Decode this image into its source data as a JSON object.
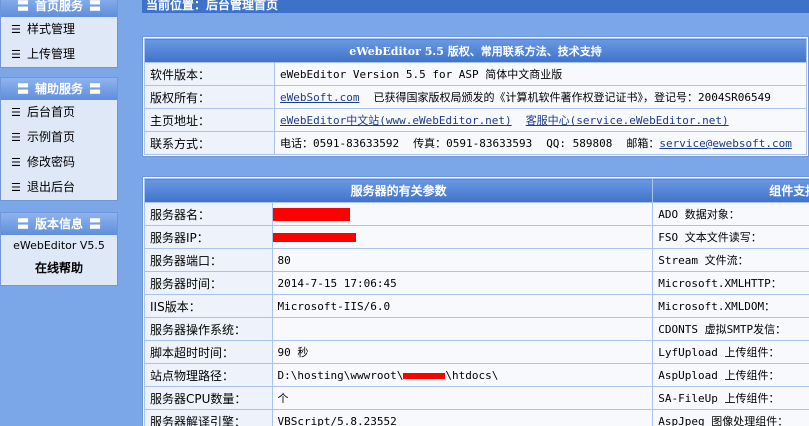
{
  "sidebar": {
    "panel1": {
      "title": "首页服务",
      "items": [
        {
          "label": "样式管理"
        },
        {
          "label": "上传管理"
        }
      ]
    },
    "panel2": {
      "title": "辅助服务",
      "items": [
        {
          "label": "后台首页"
        },
        {
          "label": "示例首页"
        },
        {
          "label": "修改密码"
        },
        {
          "label": "退出后台"
        }
      ]
    },
    "panel3": {
      "title": "版本信息",
      "version": "eWebEditor V5.5",
      "help": "在线帮助"
    },
    "eq": "〓"
  },
  "topbar": {
    "location": "当前位置：后台管理首页"
  },
  "version_table": {
    "title": "eWebEditor 5.5 版权、常用联系方法、技术支持",
    "rows": {
      "software_label": "软件版本：",
      "software_value": "eWebEditor Version 5.5 for ASP 简体中文商业版",
      "copyright_label": "版权所有：",
      "copyright_link": "eWebSoft.com",
      "copyright_text": "已获得国家版权局颁发的《计算机软件著作权登记证书》，登记号：2004SR06549",
      "homepage_label": "主页地址：",
      "homepage_link1": "eWebEditor中文站(www.eWebEditor.net)",
      "homepage_link2": "客服中心(service.eWebEditor.net)",
      "contact_label": "联系方式：",
      "phone": "电话：0591-83633592",
      "fax": "传真：0591-83633593",
      "qq": "QQ: 589808",
      "email_label": "邮箱：",
      "email_link": "service@ewebsoft.com"
    }
  },
  "server_table": {
    "header_left": "服务器的有关参数",
    "header_right": "组件支持",
    "rows": [
      {
        "key": "服务器名：",
        "value": "",
        "redacted": true,
        "comp": "ADO 数据对象："
      },
      {
        "key": "服务器IP：",
        "value": "",
        "redacted": true,
        "comp": "FSO 文本文件读写："
      },
      {
        "key": "服务器端口：",
        "value": "80",
        "comp": "Stream 文件流："
      },
      {
        "key": "服务器时间：",
        "value": "2014-7-15 17:06:45",
        "comp": "Microsoft.XMLHTTP："
      },
      {
        "key": "IIS版本：",
        "value": "Microsoft-IIS/6.0",
        "comp": "Microsoft.XMLDOM："
      },
      {
        "key": "服务器操作系统：",
        "value": "",
        "comp": "CDONTS 虚拟SMTP发信："
      },
      {
        "key": "脚本超时时间：",
        "value": "90 秒",
        "comp": "LyfUpload 上传组件："
      },
      {
        "key": "站点物理路径：",
        "value_prefix": "D:\\hosting\\wwwroot\\",
        "value_suffix": "\\htdocs\\",
        "redacted_inline": true,
        "comp": "AspUpload 上传组件："
      },
      {
        "key": "服务器CPU数量：",
        "value": "个",
        "comp": "SA-FileUp 上传组件："
      },
      {
        "key": "服务器解译引擎：",
        "value": "VBScript/5.8.23552",
        "comp": "AspJpeg 图像处理组件："
      }
    ]
  }
}
